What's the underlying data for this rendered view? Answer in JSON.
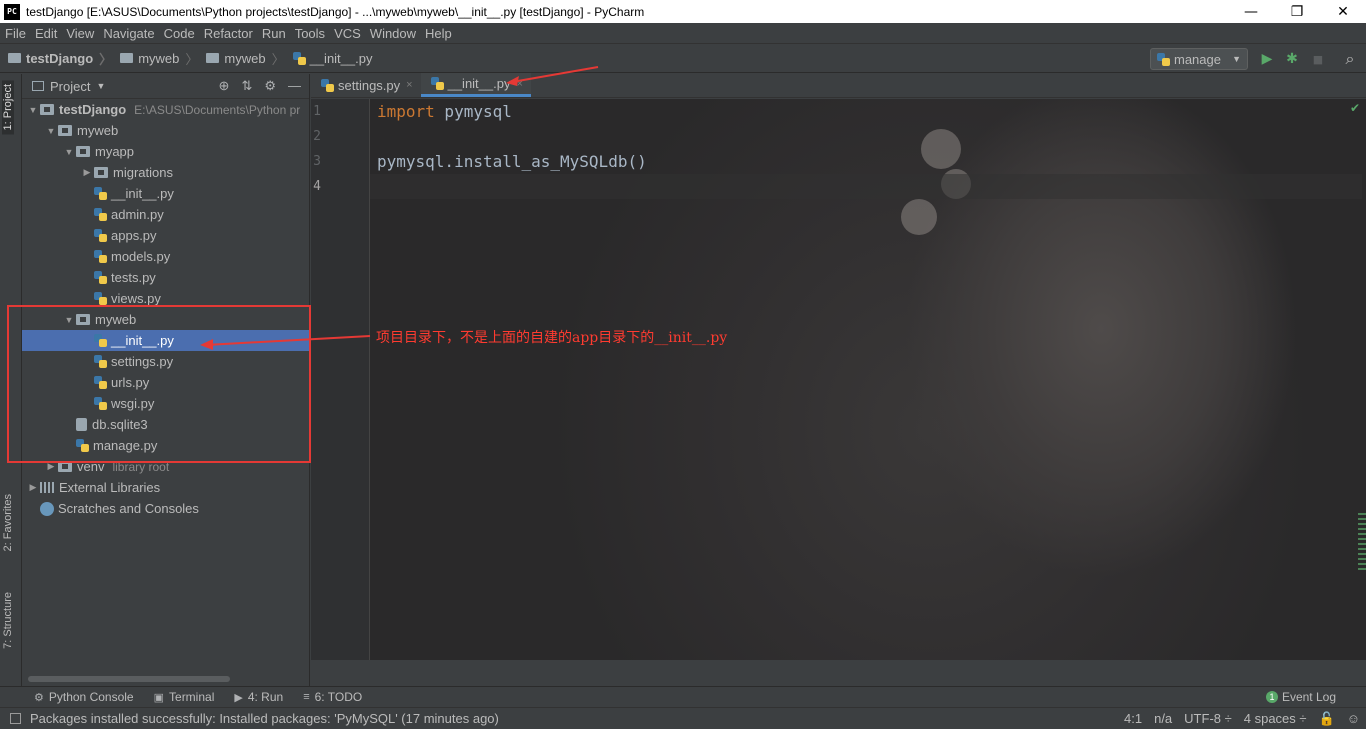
{
  "window": {
    "title": "testDjango [E:\\ASUS\\Documents\\Python projects\\testDjango] - ...\\myweb\\myweb\\__init__.py [testDjango] - PyCharm",
    "app_badge": "PC",
    "minimize": "—",
    "restore": "❐",
    "close": "✕"
  },
  "menu": [
    "File",
    "Edit",
    "View",
    "Navigate",
    "Code",
    "Refactor",
    "Run",
    "Tools",
    "VCS",
    "Window",
    "Help"
  ],
  "breadcrumb": {
    "project": "testDjango",
    "dir1": "myweb",
    "dir2": "myweb",
    "file": "__init__.py"
  },
  "run_config": {
    "label": "manage",
    "arrow": "▼"
  },
  "toolbar_icons": {
    "run": "▶",
    "debug": "✱",
    "stop": "■",
    "search": "⌕"
  },
  "left_stripe": {
    "project": "1: Project",
    "favorites": "2: Favorites",
    "structure": "7: Structure"
  },
  "project_panel": {
    "title": "Project",
    "dropdown": "▼",
    "tools": [
      "⊕",
      "⇅",
      "⚙",
      "—"
    ],
    "tree": [
      {
        "depth": 0,
        "toggle": "▼",
        "icon": "folder",
        "label": "testDjango",
        "bold": true,
        "note": "E:\\ASUS\\Documents\\Python pr"
      },
      {
        "depth": 1,
        "toggle": "▼",
        "icon": "folder",
        "label": "myweb"
      },
      {
        "depth": 2,
        "toggle": "▼",
        "icon": "folder",
        "label": "myapp"
      },
      {
        "depth": 3,
        "toggle": "▶",
        "icon": "folder",
        "label": "migrations"
      },
      {
        "depth": 3,
        "toggle": "",
        "icon": "py",
        "label": "__init__.py"
      },
      {
        "depth": 3,
        "toggle": "",
        "icon": "py",
        "label": "admin.py"
      },
      {
        "depth": 3,
        "toggle": "",
        "icon": "py",
        "label": "apps.py"
      },
      {
        "depth": 3,
        "toggle": "",
        "icon": "py",
        "label": "models.py"
      },
      {
        "depth": 3,
        "toggle": "",
        "icon": "py",
        "label": "tests.py"
      },
      {
        "depth": 3,
        "toggle": "",
        "icon": "py",
        "label": "views.py"
      },
      {
        "depth": 2,
        "toggle": "▼",
        "icon": "folder",
        "label": "myweb"
      },
      {
        "depth": 3,
        "toggle": "",
        "icon": "py",
        "label": "__init__.py",
        "selected": true
      },
      {
        "depth": 3,
        "toggle": "",
        "icon": "py",
        "label": "settings.py"
      },
      {
        "depth": 3,
        "toggle": "",
        "icon": "py",
        "label": "urls.py"
      },
      {
        "depth": 3,
        "toggle": "",
        "icon": "py",
        "label": "wsgi.py"
      },
      {
        "depth": 2,
        "toggle": "",
        "icon": "db",
        "label": "db.sqlite3"
      },
      {
        "depth": 2,
        "toggle": "",
        "icon": "py",
        "label": "manage.py"
      },
      {
        "depth": 1,
        "toggle": "▶",
        "icon": "folder",
        "label": "venv",
        "note": "library root"
      },
      {
        "depth": 0,
        "toggle": "▶",
        "icon": "lib",
        "label": "External Libraries"
      },
      {
        "depth": 0,
        "toggle": "",
        "icon": "scratch",
        "label": "Scratches and Consoles"
      }
    ]
  },
  "editor_tabs": [
    {
      "label": "settings.py",
      "close": "×",
      "active": false
    },
    {
      "label": "__init__.py",
      "close": "×",
      "active": true
    }
  ],
  "editor": {
    "line_numbers": [
      "1",
      "2",
      "3",
      "4"
    ],
    "lines": [
      {
        "kw": "import",
        "rest": " pymysql"
      },
      {
        "kw": "",
        "rest": ""
      },
      {
        "kw": "",
        "rest": "pymysql.install_as_MySQLdb()"
      },
      {
        "kw": "",
        "rest": ""
      }
    ],
    "current_line": 4,
    "ok_mark": "✔"
  },
  "annotation": {
    "text": "项目目录下，不是上面的自建的app目录下的__init__.py",
    "color": "#ff3b30"
  },
  "bottom_tools": [
    {
      "icon": "⚙",
      "label": "Python Console"
    },
    {
      "icon": "▣",
      "label": "Terminal"
    },
    {
      "icon": "▶",
      "label": "4: Run"
    },
    {
      "icon": "≡",
      "label": "6: TODO"
    }
  ],
  "event_log": {
    "count": "1",
    "label": "Event Log"
  },
  "status": {
    "message": "Packages installed successfully: Installed packages: 'PyMySQL' (17 minutes ago)",
    "position": "4:1",
    "na": "n/a",
    "encoding": "UTF-8 ÷",
    "indent": "4 spaces ÷",
    "lock": "🔓",
    "inspector": "☺"
  },
  "colors": {
    "keyword": "#cc7832",
    "code": "#a9b7c6",
    "selection": "#4b6eaf",
    "annotation_red": "#e53935"
  }
}
